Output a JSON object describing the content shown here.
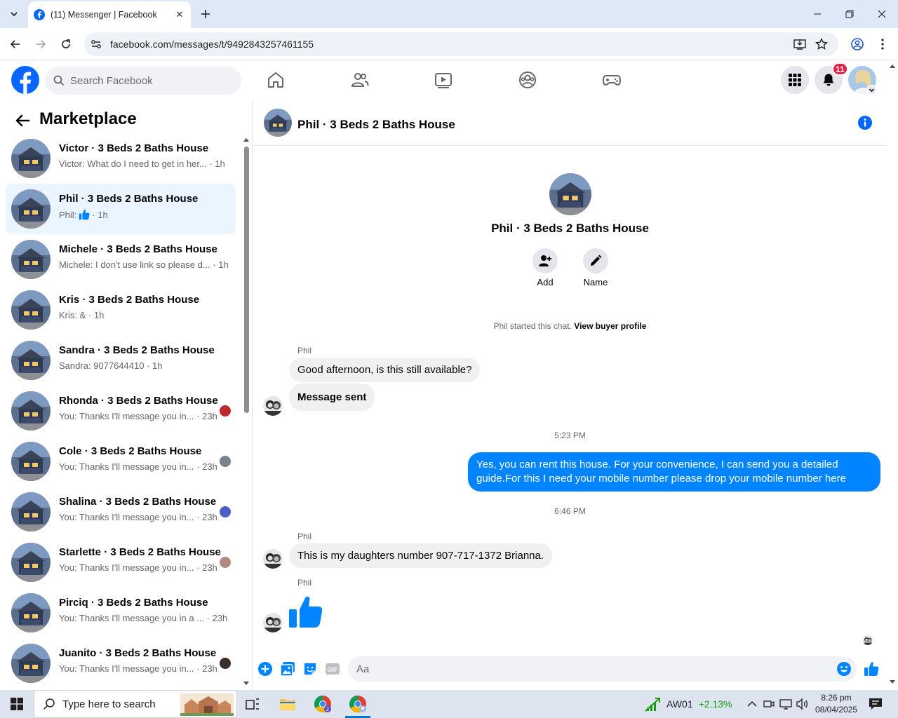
{
  "browser": {
    "tab_title": "(11) Messenger | Facebook",
    "url": "facebook.com/messages/t/9492843257461155"
  },
  "fb": {
    "search_placeholder": "Search Facebook",
    "notification_count": "11"
  },
  "sidebar": {
    "title": "Marketplace",
    "conversations": [
      {
        "name": "Victor · 3 Beds 2 Baths House",
        "preview": "Victor: What do I need to get in her... · 1h",
        "active": false,
        "seen_color": ""
      },
      {
        "name": "Phil · 3 Beds 2 Baths House",
        "preview_prefix": "Phil:",
        "preview_suffix": "· 1h",
        "active": true,
        "seen_color": ""
      },
      {
        "name": "Michele · 3 Beds 2 Baths House",
        "preview": "Michele: I don't use link so please d... · 1h",
        "active": false,
        "seen_color": ""
      },
      {
        "name": "Kris · 3 Beds 2 Baths House",
        "preview": "Kris: & · 1h",
        "active": false,
        "seen_color": ""
      },
      {
        "name": "Sandra · 3 Beds 2 Baths House",
        "preview": "Sandra: 9077644410 · 1h",
        "active": false,
        "seen_color": ""
      },
      {
        "name": "Rhonda · 3 Beds 2 Baths House",
        "preview": "You: Thanks I'll message you in... · 23h",
        "active": false,
        "seen_color": "#c0262d"
      },
      {
        "name": "Cole · 3 Beds 2 Baths House",
        "preview": "You: Thanks I'll message you in... · 23h",
        "active": false,
        "seen_color": "#7a8290"
      },
      {
        "name": "Shalina · 3 Beds 2 Baths House",
        "preview": "You: Thanks I'll message you in... · 23h",
        "active": false,
        "seen_color": "#4a5ec8"
      },
      {
        "name": "Starlette · 3 Beds 2 Baths House",
        "preview": "You: Thanks I'll message you in... · 23h",
        "active": false,
        "seen_color": "#b08a80"
      },
      {
        "name": "Pirciq · 3 Beds 2 Baths House",
        "preview": "You: Thanks I'll message you in a ... · 23h",
        "active": false,
        "seen_color": ""
      },
      {
        "name": "Juanito · 3 Beds 2 Baths House",
        "preview": "You: Thanks I'll message you in... · 23h",
        "active": false,
        "seen_color": "#3a2e2a"
      }
    ]
  },
  "chat": {
    "title": "Phil · 3 Beds 2 Baths House",
    "add_label": "Add",
    "name_label": "Name",
    "started_text": "Phil started this chat.",
    "view_profile": "View buyer profile",
    "sender1": "Phil",
    "msg1": "Good afternoon, is this still available?",
    "msg2": "Message sent",
    "time1": "5:23 PM",
    "out_msg": "Yes, you can rent this house. For your convenience, I can send you a detailed guide.For this I need your mobile number please drop your mobile number here",
    "time2": "6:46 PM",
    "sender2": "Phil",
    "msg3": "This is my daughters number 907-717-1372 Brianna.",
    "sender3": "Phil",
    "input_placeholder": "Aa"
  },
  "taskbar": {
    "search_placeholder": "Type here to search",
    "stock_name": "AW01",
    "stock_change": "+2.13%",
    "time": "8:26 pm",
    "date": "08/04/2025"
  },
  "colors": {
    "fb_blue": "#0866ff",
    "messenger_blue": "#0084ff",
    "active_conv": "#ebf5ff",
    "stock_green": "#13a10e"
  }
}
